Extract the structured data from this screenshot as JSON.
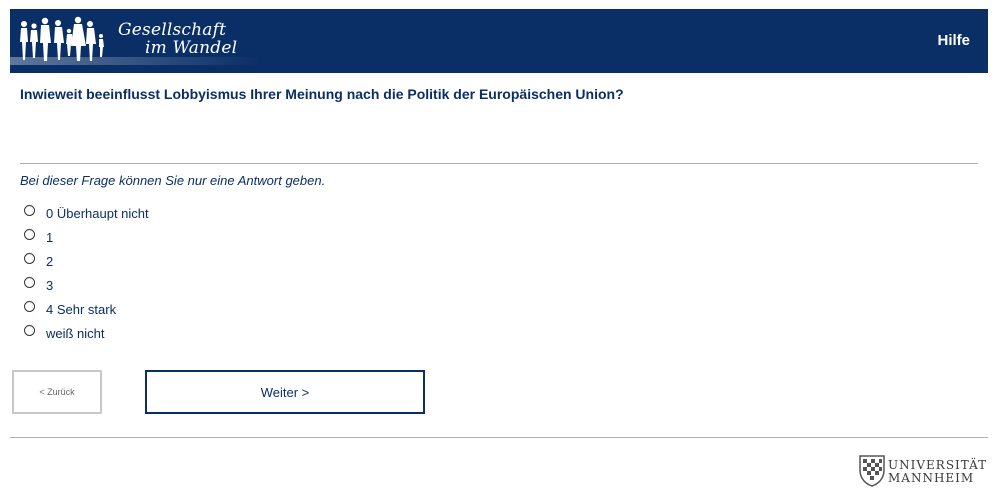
{
  "header": {
    "logo_line1": "Gesellschaft",
    "logo_line2": "im Wandel",
    "help_label": "Hilfe",
    "background_color": "#0a2f66"
  },
  "question": {
    "text": "Inwieweit beeinflusst Lobbyismus Ihrer Meinung nach die Politik der Europäischen Union?",
    "instruction": "Bei dieser Frage können Sie nur eine Antwort geben.",
    "options": [
      {
        "label": "0 Überhaupt nicht"
      },
      {
        "label": "1"
      },
      {
        "label": "2"
      },
      {
        "label": "3"
      },
      {
        "label": "4 Sehr stark"
      },
      {
        "label": "weiß nicht"
      }
    ]
  },
  "navigation": {
    "back_label": "< Zurück",
    "next_label": "Weiter >"
  },
  "footer": {
    "university_line1": "UNIVERSITÄT",
    "university_line2": "MANNHEIM"
  }
}
